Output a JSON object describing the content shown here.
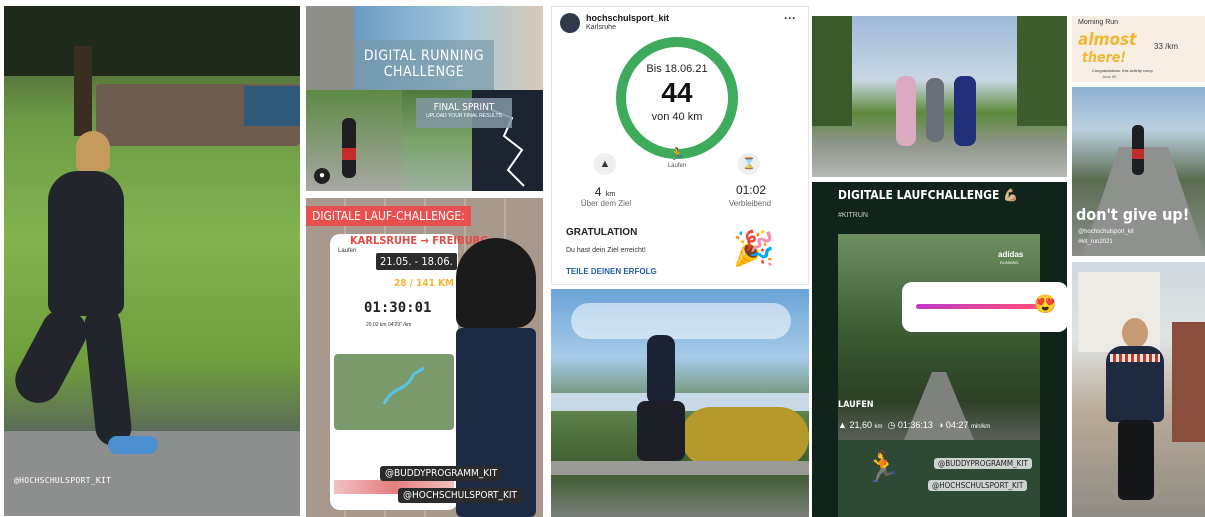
{
  "tile1": {
    "tag": "@HOCHSCHULSPORT_KIT"
  },
  "tile2": {
    "title_line1": "DIGITAL RUNNING",
    "title_line2": "CHALLENGE",
    "sprint_title": "FINAL SPRINT",
    "sprint_sub": "UPLOAD YOUR FINAL RESULTS"
  },
  "tile3": {
    "title": "DIGITALE LAUF-CHALLENGE:",
    "route": "KARLSRUHE → FREIBURG",
    "dates": "21.05. - 18.06.",
    "km": "28 / 141 KM",
    "time": "01:30:01",
    "stats": "20,02 km   04'29\" /km",
    "phone_back": "Laufen",
    "tag1": "@BUDDYPROGRAMM_KIT",
    "tag2": "@HOCHSCHULSPORT_KIT"
  },
  "tile4": {
    "account": "hochschulsport_kit",
    "location": "Karlsruhe",
    "menu": "···",
    "ring_top": "Bis 18.06.21",
    "ring_value": "44",
    "ring_bottom": "von 40 km",
    "activity": "Laufen",
    "left_value": "4",
    "left_unit": "km",
    "left_label": "Über dem Ziel",
    "right_value": "01:02",
    "right_label": "Verbleibend",
    "congrats_title": "GRATULATION",
    "congrats_text": "Du hast dein Ziel erreicht!",
    "share_link": "TEILE DEINEN ERFOLG",
    "colors": {
      "ring": "#3daa5c",
      "link": "#1f5fa8"
    }
  },
  "tile7": {
    "title": "DIGITALE LAUFCHALLENGE 💪🏼",
    "hashtag": "#KITRUN",
    "brand": "adidas",
    "brand_sub": "RUNNING",
    "activity": "LAUFEN",
    "distance": "21,60",
    "distance_unit": "km",
    "duration": "01:36:13",
    "pace": "04:27",
    "pace_unit": "min/km",
    "slider_emoji": "😍",
    "tag1": "@BUDDYPROGRAMM_KIT",
    "tag2": "@HOCHSCHULSPORT_KIT"
  },
  "tile8": {
    "heading": "Morning Run",
    "big1": "almost",
    "big2": "there!",
    "pace": "33 /km",
    "small": "Congratulations, this activity comp",
    "date": "June 6K"
  },
  "tile9": {
    "caption": "don't give up!",
    "tag": "@hochschulsport_kit",
    "hashtag": "#kit_run2021"
  }
}
